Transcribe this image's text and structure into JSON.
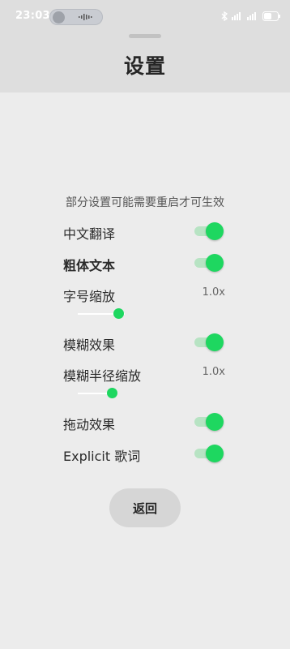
{
  "status_bar": {
    "time": "23:03",
    "icons": [
      "weather-cloud-icon",
      "audio-wave-icon",
      "bluetooth-icon",
      "network-icon",
      "wifi-icon",
      "battery-icon"
    ]
  },
  "header": {
    "title": "设置"
  },
  "notice": "部分设置可能需要重启才可生效",
  "settings": [
    {
      "label": "中文翻译",
      "type": "toggle",
      "on": true
    },
    {
      "label": "粗体文本",
      "type": "toggle",
      "on": true
    },
    {
      "label": "字号缩放",
      "type": "slider",
      "value_text": "1.0x",
      "level": 0.75
    },
    {
      "label": "模糊效果",
      "type": "toggle",
      "on": true
    },
    {
      "label": "模糊半径缩放",
      "type": "slider",
      "value_text": "1.0x",
      "level": 0.75
    },
    {
      "label": "拖动效果",
      "type": "toggle",
      "on": true
    },
    {
      "label": "Explicit 歌词",
      "type": "toggle",
      "on": true
    }
  ],
  "back_button": "返回",
  "colors": {
    "accent": "#1ed760",
    "background": "#ececec",
    "header": "#dedede"
  }
}
